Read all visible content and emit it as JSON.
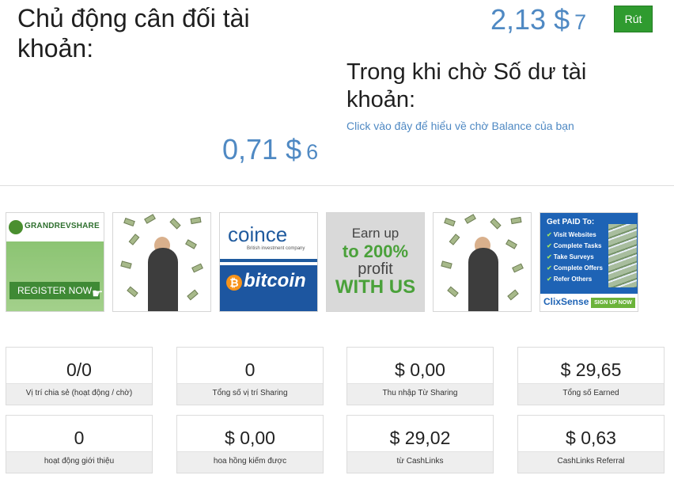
{
  "active_balance": {
    "title": "Chủ động cân đối tài khoản:",
    "amount_main": "0,71 $",
    "amount_suffix": "6"
  },
  "pending_balance": {
    "amount_main": "2,13 $",
    "amount_suffix": "7",
    "withdraw_label": "Rút",
    "title": "Trong khi chờ Số dư tài khoản:",
    "help_link": "Click vào đây để hiểu về chờ Balance của bạn"
  },
  "banners": {
    "grand": {
      "logo_text": "GRANDREVSHARE",
      "cta": "REGISTER NOW"
    },
    "coince": {
      "brand": "coince",
      "tagline": "British investment company",
      "btc": "bitcoin"
    },
    "earn": {
      "line1": "Earn up",
      "line2": "to 200%",
      "line3": "profit",
      "line4": "WITH US"
    },
    "clix": {
      "title": "Get PAID To:",
      "items": [
        "Visit Websites",
        "Complete Tasks",
        "Take Surveys",
        "Complete Offers",
        "Refer Others"
      ],
      "logo": "ClixSense",
      "signup": "SIGN UP NOW"
    }
  },
  "stats": [
    {
      "value": "0/0",
      "label": "Vị trí chia sẻ (hoạt động / chờ)"
    },
    {
      "value": "0",
      "label": "Tổng số vị trí Sharing"
    },
    {
      "value": "$ 0,00",
      "label": "Thu nhập Từ Sharing"
    },
    {
      "value": "$ 29,65",
      "label": "Tổng số Earned"
    },
    {
      "value": "0",
      "label": "hoạt động giới thiệu"
    },
    {
      "value": "$ 0,00",
      "label": "hoa hồng kiếm được"
    },
    {
      "value": "$ 29,02",
      "label": "từ CashLinks"
    },
    {
      "value": "$ 0,63",
      "label": "CashLinks Referral"
    }
  ],
  "colors": {
    "accent_blue": "#4f89c3",
    "withdraw_green": "#2f9b2f"
  }
}
